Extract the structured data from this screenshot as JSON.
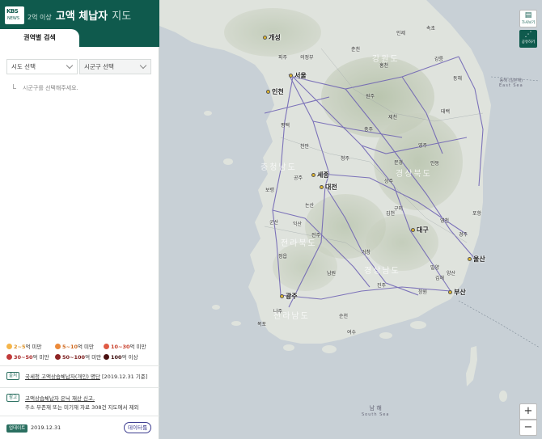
{
  "header": {
    "logo_top": "KBS",
    "logo_bottom": "NEWS",
    "title_prefix": "2억 이상",
    "title_main": "고액 체납자",
    "title_suffix": "지도",
    "tab_label": "권역별 검색"
  },
  "filters": {
    "sido_label": "시도 선택",
    "sigungu_label": "시군구 선택",
    "hint": "시군구를 선택해주세요."
  },
  "legend": [
    {
      "label_bold": "2~5",
      "label": "억 미만",
      "color": "#f5b54a"
    },
    {
      "label_bold": "5~10",
      "label": "억 미만",
      "color": "#ec8a3a"
    },
    {
      "label_bold": "10~30",
      "label": "억 미만",
      "color": "#e05a44"
    },
    {
      "label_bold": "30~50",
      "label": "억 미만",
      "color": "#c13a3a"
    },
    {
      "label_bold": "50~100",
      "label": "억 미만",
      "color": "#8e2424"
    },
    {
      "label_bold": "100",
      "label": "억 이상",
      "color": "#4a1010"
    }
  ],
  "footer": {
    "source_tag": "출처",
    "source_text": "국세청 고액상습체납자(개인) 명단",
    "source_date": "[2019.12.31 기준]",
    "ref_tag": "참고",
    "ref_line1": "고액상습체납자 은닉 재산 신고,",
    "ref_line2": "주소 부존재 또는 미기재 자료 308건 지도에서 제외",
    "update_tag": "업데이트",
    "update_date": "2019.12.31",
    "data_button": "데이터를"
  },
  "map": {
    "cities": [
      {
        "name": "개성"
      },
      {
        "name": "서울"
      },
      {
        "name": "인천"
      },
      {
        "name": "세종"
      },
      {
        "name": "대전"
      },
      {
        "name": "대구"
      },
      {
        "name": "울산"
      },
      {
        "name": "광주"
      },
      {
        "name": "부산"
      }
    ],
    "regions": [
      "강원도",
      "경상북도",
      "전라북도",
      "경상남도",
      "전라남도",
      "충청남도"
    ],
    "towns": [
      "파주",
      "의정부",
      "춘천",
      "인제",
      "속초",
      "홍천",
      "원주",
      "강릉",
      "동해",
      "태백",
      "평택",
      "천안",
      "충주",
      "제천",
      "영주",
      "청주",
      "공주",
      "보령",
      "논산",
      "안동",
      "상주",
      "김천",
      "포항",
      "경주",
      "구미",
      "영천",
      "군산",
      "익산",
      "전주",
      "정읍",
      "남원",
      "진주",
      "창원",
      "김해",
      "양산",
      "여수",
      "순천",
      "목포",
      "나주",
      "밀양",
      "거창",
      "문경"
    ],
    "seas": [
      {
        "name": "남 해",
        "en": "South Sea"
      },
      {
        "name": "동해 (일본해)",
        "en": "East Sea"
      }
    ],
    "controls": {
      "fullscreen": "가사보기",
      "share": "공유하기",
      "zoom_in": "+",
      "zoom_out": "−"
    }
  }
}
